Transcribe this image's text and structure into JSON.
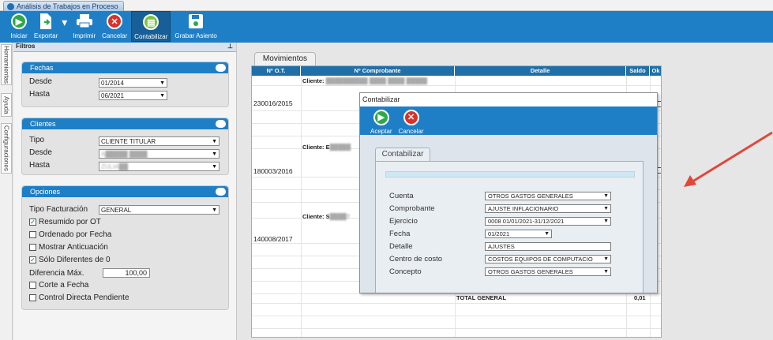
{
  "window": {
    "tab_title": "Análisis de Trabajos en Proceso"
  },
  "toolbar": {
    "buttons": [
      {
        "label": "Iniciar",
        "icon": "play-icon"
      },
      {
        "label": "Exportar",
        "icon": "export-icon"
      },
      {
        "label": "Imprimir",
        "icon": "printer-icon"
      },
      {
        "label": "Cancelar",
        "icon": "cancel-icon"
      },
      {
        "label": "Contabilizar",
        "icon": "ledger-icon"
      },
      {
        "label": "Grabar Asiento",
        "icon": "save-icon"
      }
    ]
  },
  "side_tabs": [
    "Herramientas",
    "Ayuda",
    "Configuraciones"
  ],
  "filters": {
    "title": "Filtros",
    "fechas": {
      "title": "Fechas",
      "desde_label": "Desde",
      "desde_value": "01/2014",
      "hasta_label": "Hasta",
      "hasta_value": "06/2021"
    },
    "clientes": {
      "title": "Clientes",
      "tipo_label": "Tipo",
      "tipo_value": "CLIENTE TITULAR",
      "desde_label": "Desde",
      "desde_value": "A█████ ████",
      "hasta_label": "Hasta",
      "hasta_value": "ZULIA██"
    },
    "opciones": {
      "title": "Opciones",
      "tipo_facturacion_label": "Tipo Facturación",
      "tipo_facturacion_value": "GENERAL",
      "resumido": "Resumido por OT",
      "ordenado": "Ordenado por Fecha",
      "anticuacion": "Mostrar Anticuación",
      "solo_diferentes": "Sólo Diferentes de 0",
      "diferencia_label": "Diferencia Máx.",
      "diferencia_value": "100,00",
      "corte": "Corte a Fecha",
      "control": "Control Directa Pendiente"
    }
  },
  "movimientos": {
    "tab_label": "Movimientos",
    "columns": [
      "Nº O.T.",
      "Nº Comprobante",
      "Detalle",
      "Saldo",
      "Ok"
    ],
    "clients": [
      {
        "label": "Cliente:",
        "name": "██████████ ████ ████ █████"
      },
      {
        "label": "Cliente: E",
        "name": "█████"
      },
      {
        "label": "Cliente: S",
        "name": "████T"
      }
    ],
    "ot_numbers": [
      "230016/2015",
      "180003/2016",
      "140008/2017"
    ],
    "total_label": "TOTAL GENERAL",
    "total_value": "0,01"
  },
  "dialog": {
    "title": "Contabilizar",
    "buttons": [
      {
        "label": "Aceptar",
        "icon": "accept-icon"
      },
      {
        "label": "Cancelar",
        "icon": "cancel-icon"
      }
    ],
    "tab_label": "Contabilizar",
    "fields": {
      "cuenta_label": "Cuenta",
      "cuenta_value": "OTROS GASTOS GENERALES",
      "comprobante_label": "Comprobante",
      "comprobante_value": "AJUSTE INFLACIONARIO",
      "ejercicio_label": "Ejercicio",
      "ejercicio_value": "0008 01/01/2021-31/12/2021",
      "fecha_label": "Fecha",
      "fecha_value": "01/2021",
      "detalle_label": "Detalle",
      "detalle_value": "AJUSTES",
      "centro_label": "Centro de costo",
      "centro_value": "COSTOS EQUIPOS DE COMPUTACIO",
      "concepto_label": "Concepto",
      "concepto_value": "OTROS GASTOS GENERALES"
    }
  },
  "colors": {
    "accent": "#1f7fc6",
    "annotation_arrow": "#e0473b"
  }
}
